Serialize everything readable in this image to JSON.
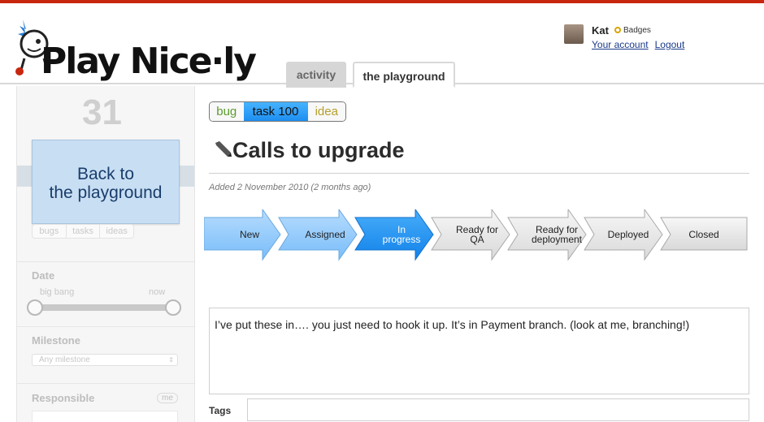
{
  "app": {
    "logo_text": "Play Nice·ly"
  },
  "user": {
    "name": "Kat",
    "badges_label": "Badges",
    "account_link": "Your account",
    "logout_link": "Logout"
  },
  "nav": {
    "tabs": [
      {
        "label": "activity",
        "active": false
      },
      {
        "label": "the playground",
        "active": true
      }
    ]
  },
  "sidebar": {
    "task_number": "31",
    "back_button": {
      "line1": "Back to",
      "line2": "the playground"
    },
    "type_filters": [
      "bugs",
      "tasks",
      "ideas"
    ],
    "date": {
      "label": "Date",
      "range_start": "big bang",
      "range_end": "now"
    },
    "milestone": {
      "label": "Milestone",
      "selected": "Any milestone"
    },
    "responsible": {
      "label": "Responsible",
      "me_tag": "me"
    }
  },
  "task": {
    "types": [
      {
        "label": "bug",
        "selected": false
      },
      {
        "label": "task 100",
        "selected": true
      },
      {
        "label": "idea",
        "selected": false
      }
    ],
    "title": "Calls to upgrade",
    "added": "Added 2 November 2010 (2 months ago)",
    "workflow": [
      {
        "line1": "New",
        "line2": "",
        "state": "done"
      },
      {
        "line1": "Assigned",
        "line2": "",
        "state": "done"
      },
      {
        "line1": "In",
        "line2": "progress",
        "state": "current"
      },
      {
        "line1": "Ready for",
        "line2": "QA",
        "state": "todo"
      },
      {
        "line1": "Ready for",
        "line2": "deployment",
        "state": "todo"
      },
      {
        "line1": "Deployed",
        "line2": "",
        "state": "todo"
      },
      {
        "line1": "Closed",
        "line2": "",
        "state": "todo"
      }
    ],
    "body": "I’ve put these in…. you just need to hook it up. It’s in Payment branch. (look at me, branching!)",
    "tags_label": "Tags",
    "tags_value": ""
  },
  "colors": {
    "brand_red": "#c8260f",
    "step_done": "#8ec7fb",
    "step_current": "#1f8ff0",
    "step_todo": "#e8e8e8"
  }
}
